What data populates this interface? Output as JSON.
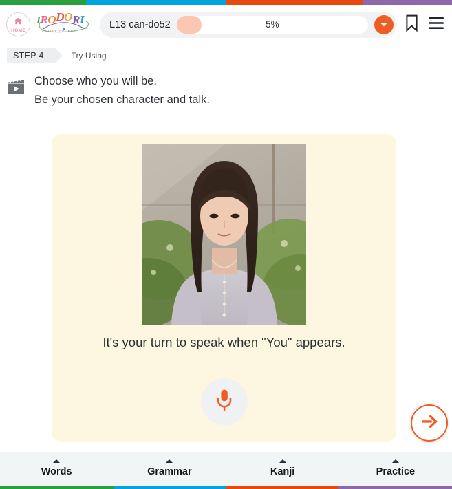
{
  "theme": {
    "strip_green": "#2aa03c",
    "strip_blue": "#00a5dd",
    "strip_orange": "#e8490f",
    "strip_purple": "#8d69ab",
    "accent_orange": "#ef5d25",
    "card_bg": "#fdf6e1",
    "progress_fill": "#fbc7b1"
  },
  "header": {
    "home_label": "HOME",
    "home_icon": "house-icon",
    "logo_text": "IRODORI",
    "logo_letters": [
      {
        "ch": "I",
        "color": "#4aa84f"
      },
      {
        "ch": "R",
        "color": "#e8598f"
      },
      {
        "ch": "O",
        "color": "#f0872b"
      },
      {
        "ch": "D",
        "color": "#d9534f"
      },
      {
        "ch": "O",
        "color": "#e8a33d"
      },
      {
        "ch": "R",
        "color": "#7b5ea7"
      },
      {
        "ch": "I",
        "color": "#2f9fd4"
      }
    ],
    "logo_subtitle": "ONLINE COURSE",
    "lesson_label": "L13 can-do52",
    "progress_percent_text": "5%",
    "progress_percent_value": 5,
    "dropdown_icon": "chevron-down-icon",
    "bookmark_icon": "bookmark-icon",
    "menu_icon": "hamburger-menu-icon"
  },
  "step": {
    "chip_label": "STEP 4",
    "title": "Try Using"
  },
  "instruction": {
    "icon": "clapperboard-play-icon",
    "line1": "Choose who you will be.",
    "line2": "Be your chosen character and talk."
  },
  "card": {
    "photo_alt": "woman-portrait-photo",
    "caption": "It's your turn to speak when \"You\" appears.",
    "mic_icon": "microphone-icon"
  },
  "next_button": {
    "icon": "arrow-right-icon",
    "label": "Next"
  },
  "bottom_nav": {
    "tabs": [
      {
        "label": "Words",
        "color": "#2aa03c",
        "caret": "caret-up-icon"
      },
      {
        "label": "Grammar",
        "color": "#00a5dd",
        "caret": "caret-up-icon"
      },
      {
        "label": "Kanji",
        "color": "#e8490f",
        "caret": "caret-up-icon"
      },
      {
        "label": "Practice",
        "color": "#8d69ab",
        "caret": "caret-up-icon"
      }
    ]
  }
}
